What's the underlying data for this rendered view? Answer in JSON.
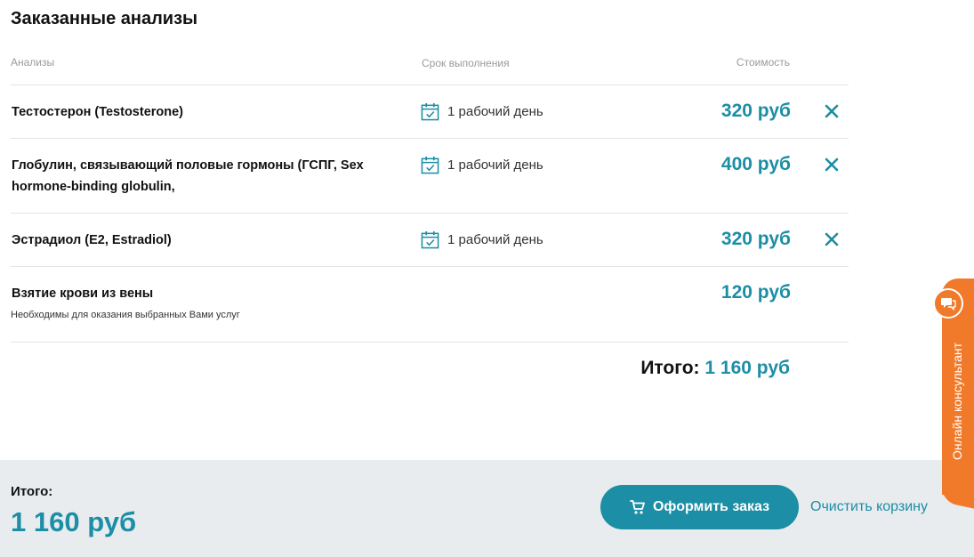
{
  "page_title": "Заказанные анализы",
  "table": {
    "headers": {
      "name": "Анализы",
      "term": "Срок выполнения",
      "price": "Стоимость"
    },
    "rows": [
      {
        "name": "Тестостерон (Testosterone)",
        "term": "1 рабочий день",
        "price": "320 руб"
      },
      {
        "name": "Глобулин, связывающий половые гормоны (ГСПГ, Sex hormone-binding globulin,",
        "term": "1 рабочий день",
        "price": "400 руб"
      },
      {
        "name": "Эстрадиол (E2, Estradiol)",
        "term": "1 рабочий день",
        "price": "320 руб"
      }
    ],
    "service": {
      "name": "Взятие крови из вены",
      "note": "Необходимы для оказания выбранных Вами услуг",
      "price": "120 руб"
    }
  },
  "total_line": {
    "label": "Итого:",
    "value": "1 160 руб"
  },
  "footer": {
    "label": "Итого:",
    "amount": "1 160 руб",
    "order_button": "Оформить заказ",
    "clear_link": "Очистить корзину"
  },
  "consultant": {
    "label": "Онлайн консультант"
  },
  "colors": {
    "accent": "#1c8ea5",
    "consultant": "#f07a2a",
    "footer_bg": "#e8ecee"
  },
  "icons": {
    "term": "calendar-check-icon",
    "remove": "close-icon",
    "order": "cart-icon",
    "consultant": "chat-bubble-icon"
  }
}
